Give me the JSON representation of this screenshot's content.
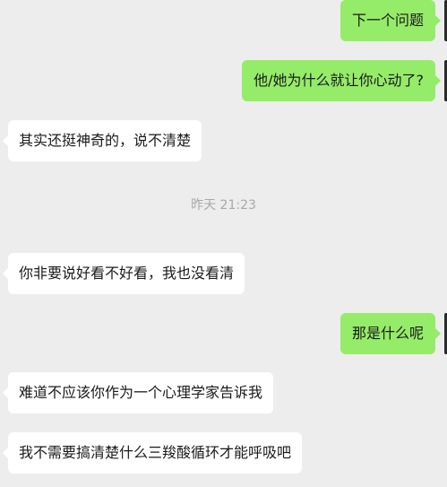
{
  "messages": [
    {
      "side": "out",
      "text": "下一个问题"
    },
    {
      "side": "out",
      "text": "他/她为什么就让你心动了?"
    },
    {
      "side": "in",
      "text": "其实还挺神奇的，说不清楚"
    },
    {
      "side": "in",
      "text": "你非要说好看不好看，我也没看清"
    },
    {
      "side": "out",
      "text": "那是什么呢"
    },
    {
      "side": "in",
      "text": "难道不应该你作为一个心理学家告诉我"
    },
    {
      "side": "in",
      "text": "我不需要搞清楚什么三羧酸循环才能呼吸吧"
    }
  ],
  "timestamp": "昨天 21:23",
  "colors": {
    "background": "#ededed",
    "incoming_bubble": "#ffffff",
    "outgoing_bubble": "#95ec69",
    "timestamp_text": "#a8a8a8"
  }
}
